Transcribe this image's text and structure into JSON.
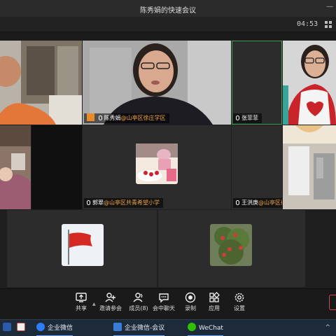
{
  "window": {
    "title": "陈秀娟的快速会议"
  },
  "meeting": {
    "timer": "04:53"
  },
  "participants": [
    {
      "name": "陈秀娟",
      "org": "@山亭区徐庄学区"
    },
    {
      "name": "张菲菲",
      "org": ""
    },
    {
      "name": "郭翠",
      "org": "@山亭区共青希望小学"
    },
    {
      "name": "王洪庚",
      "org": "@山亭区徐庄镇宝隆·华辉范岭希"
    }
  ],
  "toolbar": {
    "share": "共享",
    "invite": "邀请参会",
    "members": "成员(8)",
    "chat": "会中聊天",
    "record": "录制",
    "apps": "应用",
    "settings": "设置"
  },
  "taskbar": {
    "items": [
      {
        "label": "企业微信",
        "color": "#2f7df6"
      },
      {
        "label": "企业微信-会议",
        "color": "#3a7bd5"
      },
      {
        "label": "WeChat",
        "color": "#2dc100"
      }
    ]
  },
  "icons": {
    "mic": "microphone-icon",
    "share": "screen-share-icon",
    "invite": "add-person-icon",
    "members": "people-icon",
    "chat": "chat-bubble-icon",
    "record": "record-icon",
    "apps": "apps-grid-icon",
    "settings": "gear-icon"
  }
}
